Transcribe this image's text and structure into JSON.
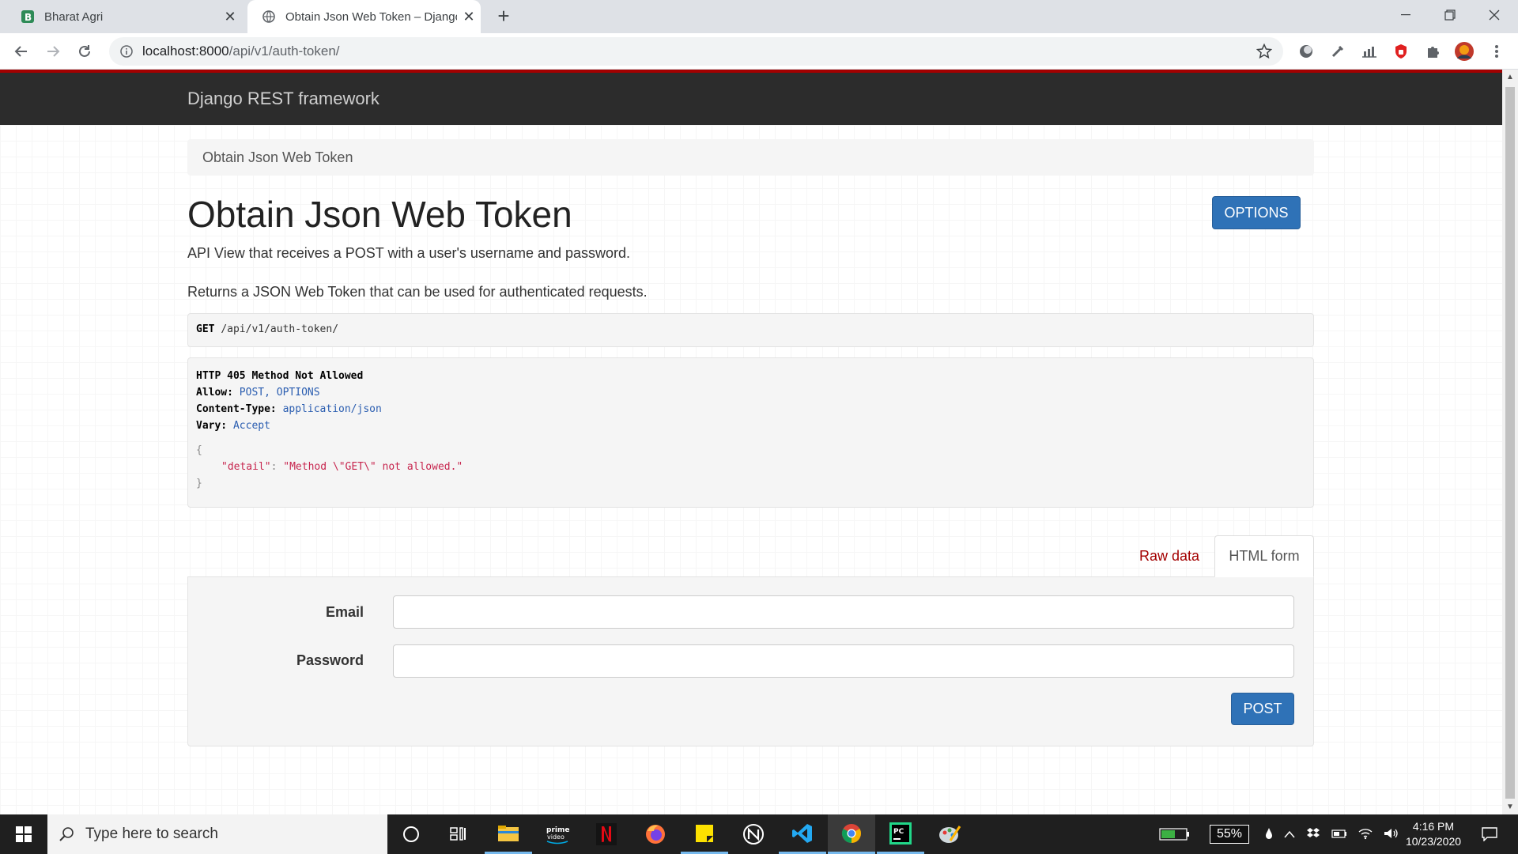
{
  "browser": {
    "tabs": [
      {
        "title": "Bharat Agri",
        "active": false
      },
      {
        "title": "Obtain Json Web Token – Django",
        "active": true
      }
    ],
    "url_host": "localhost:8000",
    "url_path": "/api/v1/auth-token/"
  },
  "drf": {
    "brand": "Django REST framework",
    "breadcrumb": "Obtain Json Web Token",
    "title": "Obtain Json Web Token",
    "options_label": "OPTIONS",
    "description_1": "API View that receives a POST with a user's username and password.",
    "description_2": "Returns a JSON Web Token that can be used for authenticated requests.",
    "request": {
      "method": "GET",
      "path": "/api/v1/auth-token/"
    },
    "response": {
      "status_line": "HTTP 405 Method Not Allowed",
      "allow_key": "Allow:",
      "allow_val": "POST, OPTIONS",
      "ctype_key": "Content-Type:",
      "ctype_val": "application/json",
      "vary_key": "Vary:",
      "vary_val": "Accept",
      "brace_open": "{",
      "detail_key": "\"detail\"",
      "detail_sep": ": ",
      "detail_val": "\"Method \\\"GET\\\" not allowed.\"",
      "brace_close": "}"
    },
    "form_tabs": {
      "raw": "Raw data",
      "html": "HTML form"
    },
    "form": {
      "email_label": "Email",
      "password_label": "Password",
      "email_value": "",
      "password_value": "",
      "submit_label": "POST"
    },
    "colors": {
      "navbar": "#2c2c2c",
      "accent_red": "#a30000",
      "button_blue": "#2f72b7"
    }
  },
  "taskbar": {
    "search_placeholder": "Type here to search",
    "battery_percent": "55%",
    "time": "4:16 PM",
    "date": "10/23/2020",
    "apps": [
      "cortana-icon",
      "task-view-icon",
      "file-explorer-icon",
      "prime-video-icon",
      "netflix-icon",
      "firefox-icon",
      "sticky-notes-icon",
      "app-icon",
      "vscode-icon",
      "chrome-icon",
      "pycharm-icon",
      "paint-icon"
    ]
  }
}
